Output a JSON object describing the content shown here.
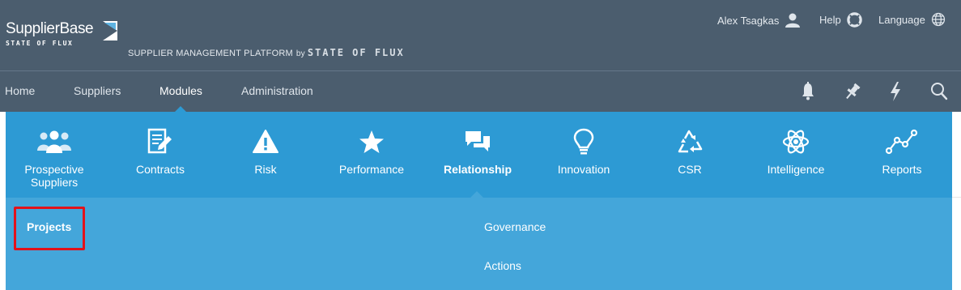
{
  "brand": {
    "name": "SupplierBase",
    "sub": "STATE OF FLUX",
    "tagline": "SUPPLIER MANAGEMENT PLATFORM",
    "tagline_by": "by",
    "tagline_brand": "STATE OF FLUX"
  },
  "utility": {
    "user": "Alex Tsagkas",
    "help": "Help",
    "language": "Language"
  },
  "nav": {
    "items": [
      {
        "label": "Home"
      },
      {
        "label": "Suppliers"
      },
      {
        "label": "Modules",
        "active": true
      },
      {
        "label": "Administration"
      }
    ],
    "icons": [
      "bell-icon",
      "pin-icon",
      "lightning-icon",
      "search-icon"
    ]
  },
  "modules": [
    {
      "label": "Prospective Suppliers",
      "icon": "users-icon"
    },
    {
      "label": "Contracts",
      "icon": "document-edit-icon"
    },
    {
      "label": "Risk",
      "icon": "warning-icon"
    },
    {
      "label": "Performance",
      "icon": "star-icon"
    },
    {
      "label": "Relationship",
      "icon": "chat-icon",
      "active": true
    },
    {
      "label": "Innovation",
      "icon": "lightbulb-icon"
    },
    {
      "label": "CSR",
      "icon": "recycle-icon"
    },
    {
      "label": "Intelligence",
      "icon": "atom-icon"
    },
    {
      "label": "Reports",
      "icon": "line-chart-icon"
    }
  ],
  "submenu": {
    "items": [
      {
        "label": "Projects",
        "highlighted": true
      },
      {
        "label": "Governance"
      },
      {
        "label": "Actions"
      }
    ]
  },
  "colors": {
    "header": "#4b5d6e",
    "menu": "#2d9ad4",
    "submenu": "#44a6da",
    "highlight": "#e3121b"
  }
}
